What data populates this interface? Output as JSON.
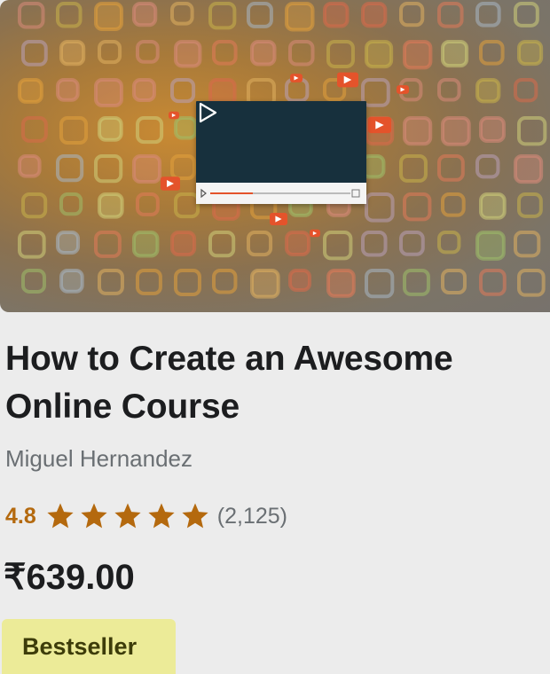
{
  "course": {
    "thumbnail_icon": "video-player-icon",
    "title_line1": "How to Create an Awesome",
    "title_line2": "Online Course",
    "author": "Miguel Hernandez",
    "rating": "4.8",
    "stars_filled": 5,
    "rating_count": "(2,125)",
    "price": "₹639.00",
    "badge": "Bestseller"
  },
  "colors": {
    "rating": "#b4690e",
    "badge_bg": "#eceb98",
    "badge_text": "#3d3c0a",
    "play_accent": "#e4532b"
  }
}
